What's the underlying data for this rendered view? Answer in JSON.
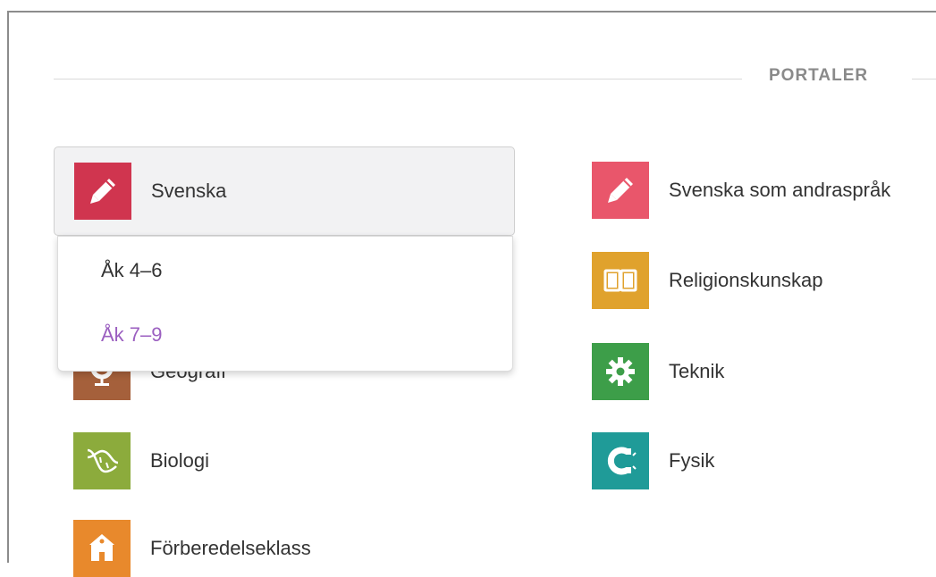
{
  "section": {
    "heading": "PORTALER"
  },
  "subjects": {
    "svenska": {
      "label": "Svenska",
      "color": "#d0354f",
      "icon": "pencil-icon"
    },
    "geografi": {
      "label": "Geografi",
      "color": "#a5603b",
      "icon": "globe-icon"
    },
    "biologi": {
      "label": "Biologi",
      "color": "#8cab3c",
      "icon": "dna-icon"
    },
    "forberedelseklass": {
      "label": "Förberedelseklass",
      "color": "#e8892c",
      "icon": "school-icon"
    },
    "sva": {
      "label": "Svenska som andraspråk",
      "color": "#e9566b",
      "icon": "pencil-icon"
    },
    "religion": {
      "label": "Religionskunskap",
      "color": "#e0a22d",
      "icon": "book-icon"
    },
    "teknik": {
      "label": "Teknik",
      "color": "#3d9e49",
      "icon": "gear-icon"
    },
    "fysik": {
      "label": "Fysik",
      "color": "#1f9b98",
      "icon": "magnet-icon"
    }
  },
  "dropdown": {
    "options": [
      "Åk 4–6",
      "Åk 7–9"
    ],
    "highlight_color": "#9b5fc0"
  }
}
